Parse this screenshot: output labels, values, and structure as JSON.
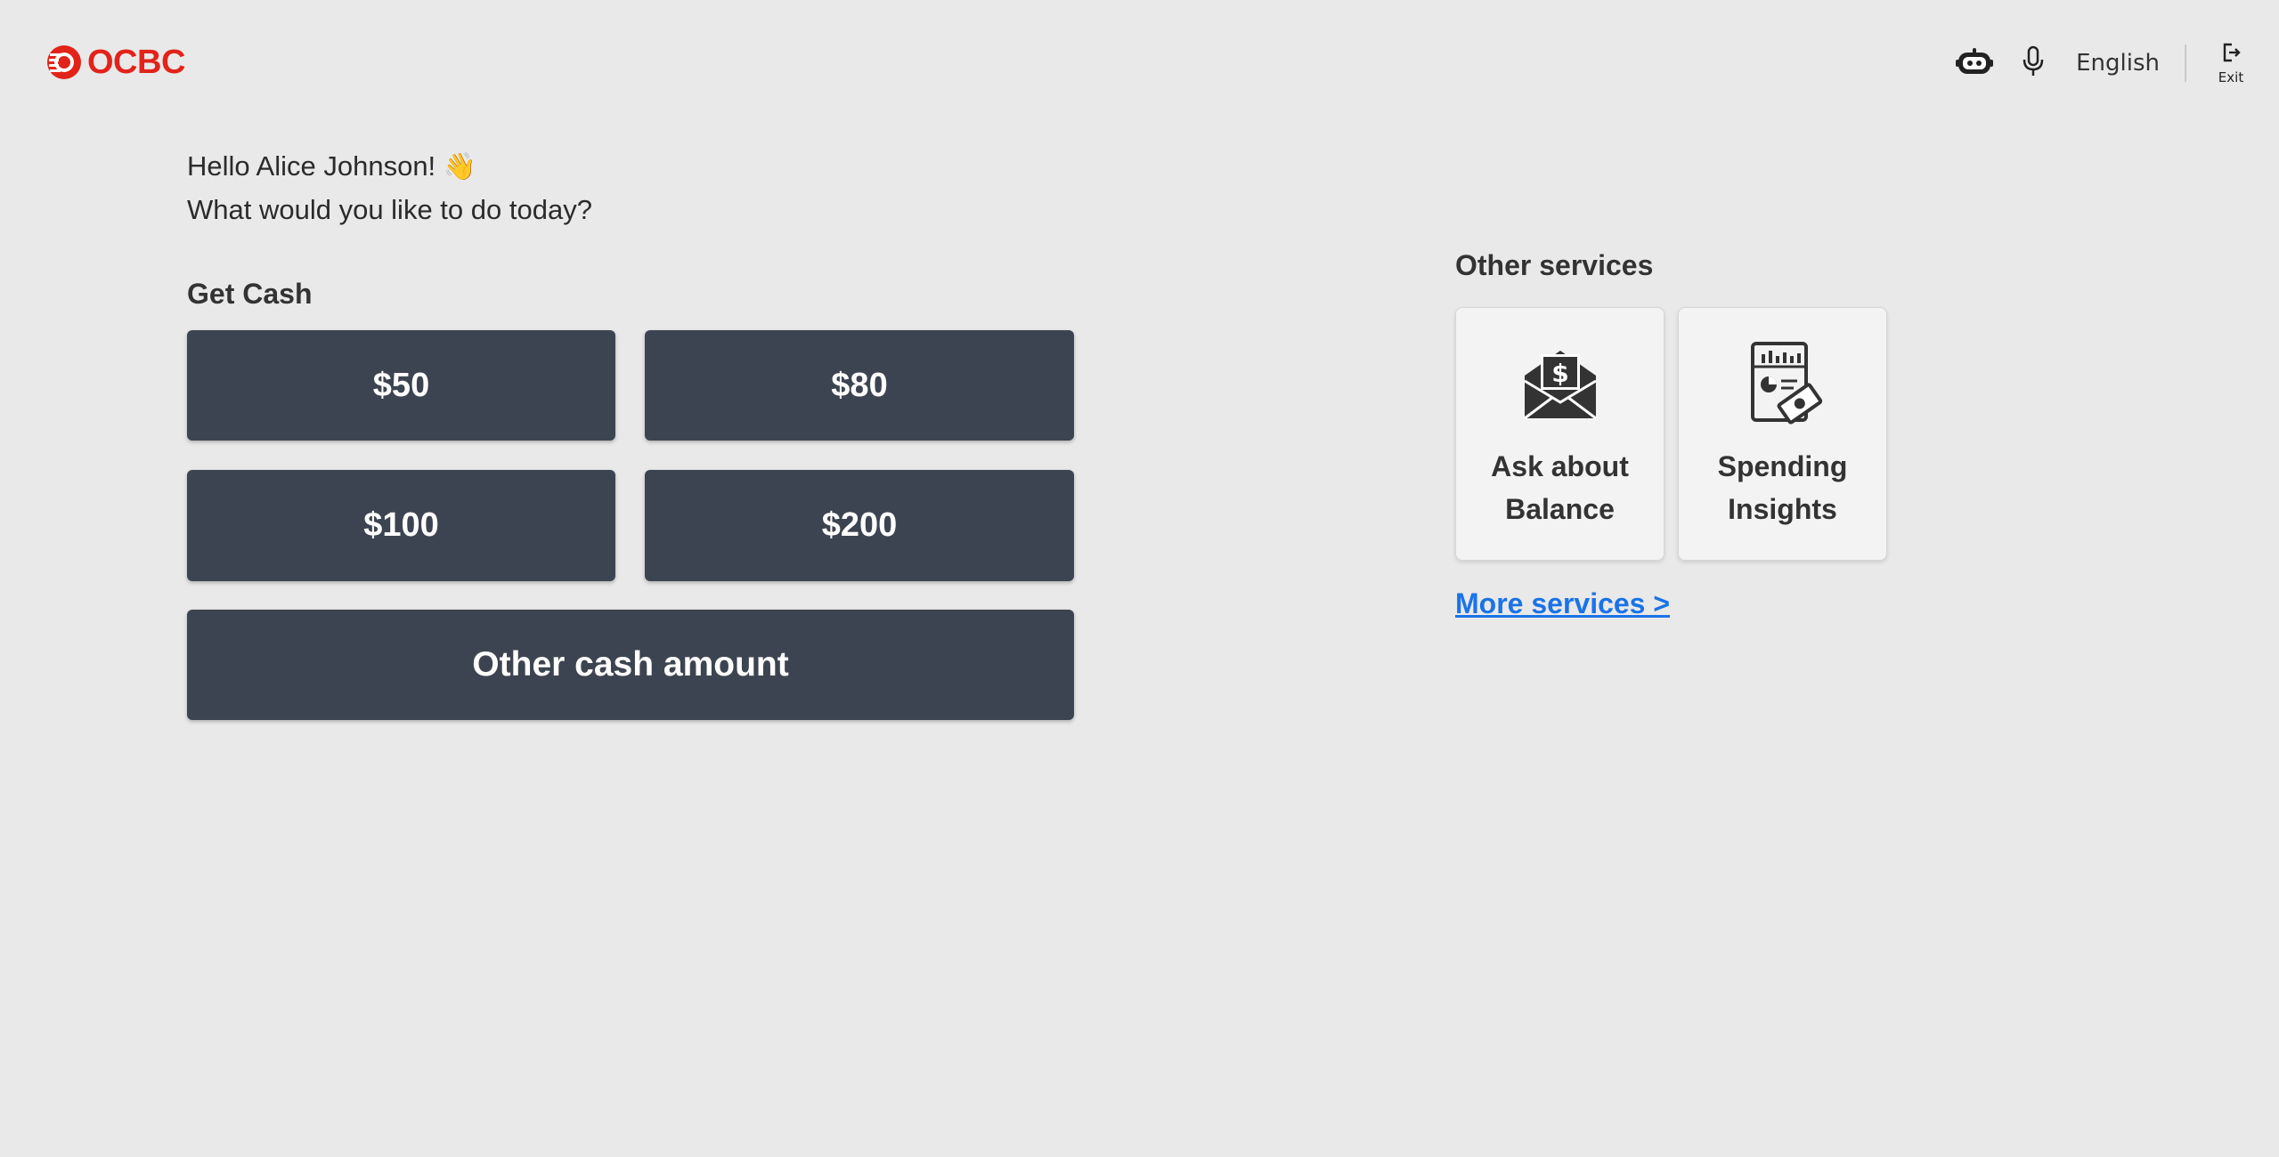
{
  "header": {
    "brand": "OCBC",
    "language": "English",
    "exit_label": "Exit",
    "icons": {
      "assistant": "robot-icon",
      "voice": "microphone-icon",
      "exit": "exit-icon"
    }
  },
  "greeting": {
    "line1": "Hello Alice Johnson!",
    "emoji": "👋",
    "line2": "What would you like to do today?"
  },
  "get_cash": {
    "title": "Get Cash",
    "amounts": [
      "$50",
      "$80",
      "$100",
      "$200"
    ],
    "other_label": "Other cash amount"
  },
  "other_services": {
    "title": "Other services",
    "cards": [
      {
        "line1": "Ask about",
        "line2": "Balance",
        "icon": "money-envelope-icon"
      },
      {
        "line1": "Spending",
        "line2": "Insights",
        "icon": "spending-report-icon"
      }
    ],
    "more_link": "More services >"
  },
  "colors": {
    "background": "#e9e9e9",
    "brand_red": "#e2231a",
    "button_dark": "#3d4451",
    "link_blue": "#1a73e8"
  }
}
